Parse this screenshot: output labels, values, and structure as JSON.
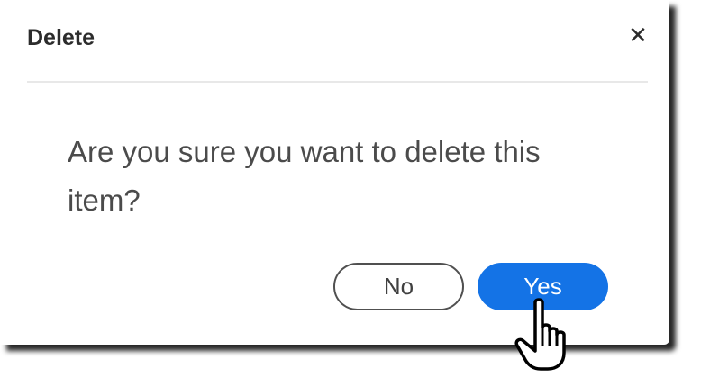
{
  "dialog": {
    "title": "Delete",
    "close_icon": "close-icon",
    "close_glyph": "✕",
    "message": "Are you sure you want to delete this item?",
    "buttons": {
      "no_label": "No",
      "yes_label": "Yes"
    },
    "cursor_icon": "hand-pointer-icon"
  },
  "colors": {
    "primary": "#1473e6",
    "text": "#2c2c2c",
    "secondary_border": "#505050"
  }
}
